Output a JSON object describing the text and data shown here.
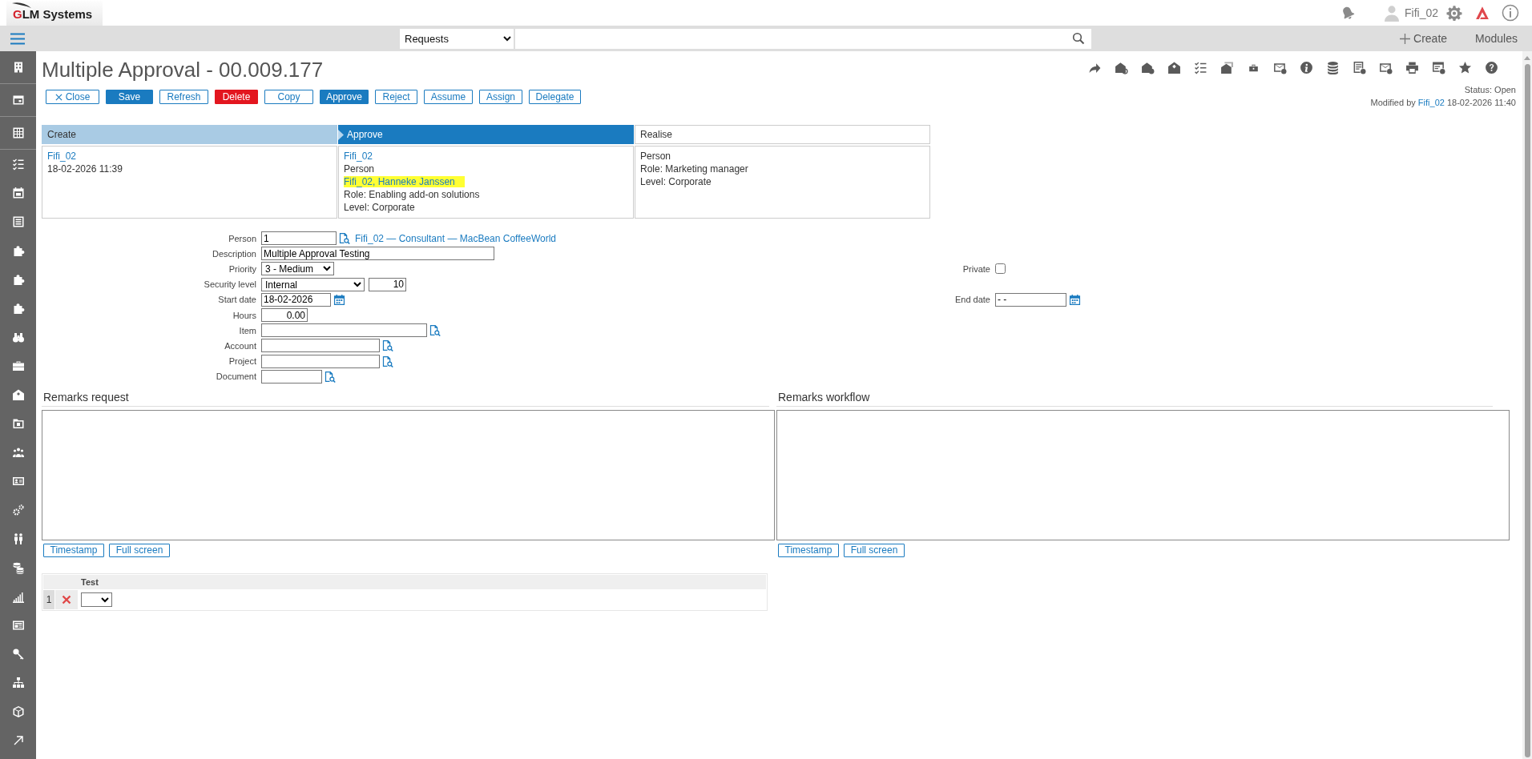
{
  "header": {
    "logo": "GLM Systems",
    "user": "Fifi_02"
  },
  "navbar": {
    "module": "Requests",
    "create": "Create",
    "modules": "Modules"
  },
  "record": {
    "title": "Multiple Approval - 00.009.177",
    "actions": [
      {
        "label": "Close",
        "kind": "close"
      },
      {
        "label": "Save",
        "kind": "primary"
      },
      {
        "label": "Refresh",
        "kind": "outline"
      },
      {
        "label": "Delete",
        "kind": "danger"
      },
      {
        "label": "Copy",
        "kind": "outline"
      },
      {
        "label": "Approve",
        "kind": "primary"
      },
      {
        "label": "Reject",
        "kind": "outline"
      },
      {
        "label": "Assume",
        "kind": "outline"
      },
      {
        "label": "Assign",
        "kind": "outline"
      },
      {
        "label": "Delegate",
        "kind": "outline"
      }
    ],
    "status": "Status: Open",
    "modified": {
      "prefix": "Modified by",
      "user": "Fifi_02",
      "time": "18-02-2026 11:40"
    }
  },
  "workflow": {
    "steps": [
      {
        "name": "Create",
        "completed": true,
        "selected": false,
        "lines": [
          {
            "kind": "link",
            "text": "Fifi_02"
          },
          {
            "kind": "text",
            "text": "18-02-2026 11:39"
          }
        ]
      },
      {
        "name": "Approve",
        "completed": false,
        "selected": true,
        "lines": [
          {
            "kind": "link",
            "text": "Fifi_02"
          },
          {
            "kind": "text",
            "text": "Person"
          },
          {
            "kind": "highlight",
            "text": "Fifi_02, Hanneke Janssen"
          },
          {
            "kind": "text",
            "text": "Role: Enabling add-on solutions"
          },
          {
            "kind": "text",
            "text": "Level: Corporate"
          }
        ]
      },
      {
        "name": "Realise",
        "completed": false,
        "selected": false,
        "lines": [
          {
            "kind": "text",
            "text": "Person"
          },
          {
            "kind": "text",
            "text": "Role: Marketing manager"
          },
          {
            "kind": "text",
            "text": "Level: Corporate"
          }
        ]
      }
    ]
  },
  "form": {
    "fields": [
      {
        "label": "Person",
        "kind": "lookup",
        "value": "1",
        "link": "Fifi_02 — Consultant — MacBean CoffeeWorld"
      },
      {
        "label": "Description",
        "kind": "text",
        "value": "Multiple Approval Testing"
      },
      {
        "label": "Priority",
        "kind": "select",
        "value": "3 - Medium",
        "side": {
          "label": "Private",
          "kind": "checkbox",
          "checked": false
        }
      },
      {
        "label": "Security level",
        "kind": "select",
        "value": "Internal",
        "extra": "10"
      },
      {
        "label": "Start date",
        "kind": "date",
        "value": "18-02-2026",
        "side": {
          "label": "End date",
          "kind": "date",
          "value": "- -"
        }
      },
      {
        "label": "Hours",
        "kind": "number",
        "value": "0.00"
      },
      {
        "label": "Item",
        "kind": "lookup"
      },
      {
        "label": "Account",
        "kind": "lookup"
      },
      {
        "label": "Project",
        "kind": "lookup"
      },
      {
        "label": "Document",
        "kind": "lookup"
      }
    ]
  },
  "remarks": [
    {
      "title": "Remarks request",
      "buttons": [
        "Timestamp",
        "Full screen"
      ]
    },
    {
      "title": "Remarks workflow",
      "buttons": [
        "Timestamp",
        "Full screen"
      ]
    }
  ],
  "grid": {
    "columns": [
      "Test"
    ],
    "rows": [
      {
        "number": "1"
      }
    ]
  }
}
